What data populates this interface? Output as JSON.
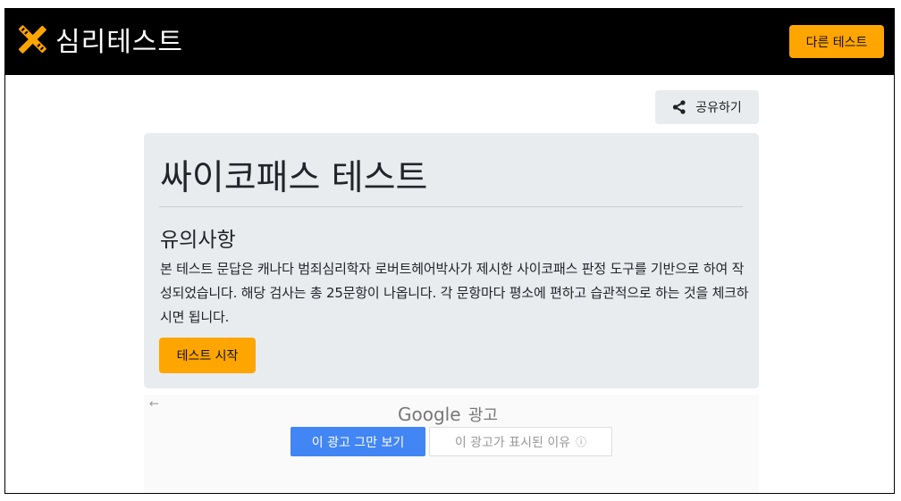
{
  "brand": {
    "name": "심리테스트",
    "icon": "pencil-ruler-icon"
  },
  "nav": {
    "other_test_label": "다른 테스트"
  },
  "share": {
    "label": "공유하기",
    "icon": "share-icon"
  },
  "jumbotron": {
    "title": "싸이코패스 테스트",
    "notice_heading": "유의사항",
    "notice_body": "본 테스트 문답은 캐나다 범죄심리학자 로버트헤어박사가 제시한 사이코패스 판정 도구를 기반으로 하여 작성되었습니다. 해당 검사는 총 25문항이 나옵니다. 각 문항마다 평소에 편하고 습관적으로 하는 것을 체크하시면 됩니다.",
    "start_label": "테스트 시작"
  },
  "ad": {
    "back_icon": "back-arrow-icon",
    "provider": "Google",
    "label": "광고",
    "stop_label": "이 광고 그만 보기",
    "why_label": "이 광고가 표시된 이유",
    "info_icon": "info-icon"
  },
  "colors": {
    "accent": "#ffa500",
    "navbar": "#000000",
    "panel": "#e9ecef",
    "ad_button": "#4285f4"
  }
}
